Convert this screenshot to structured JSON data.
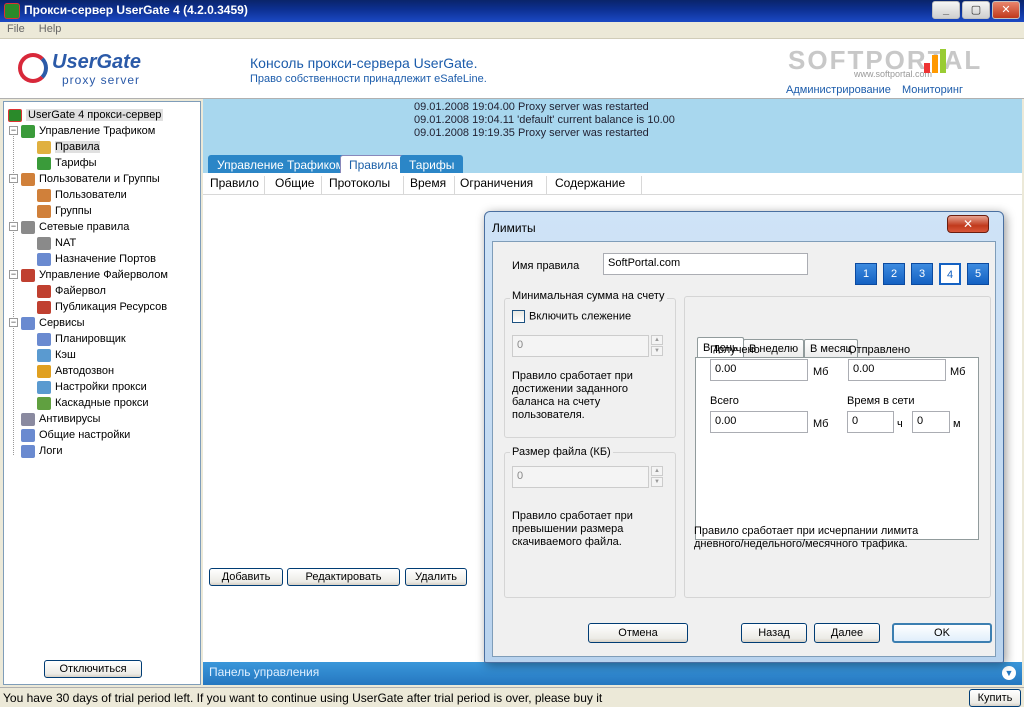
{
  "window": {
    "title": "Прокси-сервер UserGate 4 (4.2.0.3459)",
    "buttons": {
      "minimize": "_",
      "maximize": "▢",
      "close": "✕"
    }
  },
  "menu": [
    "File",
    "Help"
  ],
  "header": {
    "logo_brand": "UserGate",
    "logo_sub": "proxy server",
    "title": "Консоль прокси-сервера UserGate.",
    "subtitle": "Право собственности принадлежит eSafeLine.",
    "watermark_big": "SOFTPORTAL",
    "watermark_small": "www.softportal.com",
    "links": [
      "Администрирование",
      "Мониторинг"
    ]
  },
  "tree": {
    "root": "UserGate 4 прокси-сервер",
    "items": [
      {
        "label": "Управление Трафиком",
        "level": 1,
        "icon": "traffic-icon",
        "color": "#3a9b3a"
      },
      {
        "label": "Правила",
        "level": 2,
        "icon": "rules-icon",
        "color": "#e0b040",
        "selected": true
      },
      {
        "label": "Тарифы",
        "level": 2,
        "icon": "tariffs-icon",
        "color": "#3a9b3a"
      },
      {
        "label": "Пользователи и Группы",
        "level": 1,
        "icon": "users-groups-icon",
        "color": "#d0803a"
      },
      {
        "label": "Пользователи",
        "level": 2,
        "icon": "user-icon",
        "color": "#d0803a"
      },
      {
        "label": "Группы",
        "level": 2,
        "icon": "group-icon",
        "color": "#d0803a"
      },
      {
        "label": "Сетевые правила",
        "level": 1,
        "icon": "network-rules-icon",
        "color": "#8a8a8a"
      },
      {
        "label": "NAT",
        "level": 2,
        "icon": "nat-icon",
        "color": "#8a8a8a"
      },
      {
        "label": "Назначение Портов",
        "level": 2,
        "icon": "ports-icon",
        "color": "#6a8ad0"
      },
      {
        "label": "Управление Файерволом",
        "level": 1,
        "icon": "firewall-manage-icon",
        "color": "#c04030"
      },
      {
        "label": "Файервол",
        "level": 2,
        "icon": "firewall-icon",
        "color": "#c04030"
      },
      {
        "label": "Публикация Ресурсов",
        "level": 2,
        "icon": "publish-icon",
        "color": "#c04030"
      },
      {
        "label": "Сервисы",
        "level": 1,
        "icon": "services-icon",
        "color": "#6a8ad0"
      },
      {
        "label": "Планировщик",
        "level": 2,
        "icon": "scheduler-icon",
        "color": "#6a8ad0"
      },
      {
        "label": "Кэш",
        "level": 2,
        "icon": "cache-icon",
        "color": "#5a9ad0"
      },
      {
        "label": "Автодозвон",
        "level": 2,
        "icon": "autodial-icon",
        "color": "#e0a020"
      },
      {
        "label": "Настройки прокси",
        "level": 2,
        "icon": "proxy-settings-icon",
        "color": "#5a9ad0"
      },
      {
        "label": "Каскадные прокси",
        "level": 2,
        "icon": "cascade-proxy-icon",
        "color": "#60a040"
      },
      {
        "label": "Антивирусы",
        "level": 1,
        "icon": "antivirus-icon",
        "color": "#8a8aa0"
      },
      {
        "label": "Общие настройки",
        "level": 1,
        "icon": "settings-icon",
        "color": "#6a8ad0"
      },
      {
        "label": "Логи",
        "level": 1,
        "icon": "logs-icon",
        "color": "#6a8ad0"
      }
    ],
    "disconnect": "Отключиться"
  },
  "log": [
    "09.01.2008 19:04.00 Proxy server was restarted",
    "09.01.2008 19:04.11 'default' current balance is 10.00",
    "09.01.2008 19:19.35 Proxy server was restarted"
  ],
  "tabs": [
    "Управление Трафиком",
    "Правила",
    "Тарифы"
  ],
  "columns": [
    "Правило",
    "Общие",
    "Протоколы",
    "Время",
    "Ограничения",
    "Содержание"
  ],
  "actions": {
    "add": "Добавить",
    "edit": "Редактировать",
    "delete": "Удалить"
  },
  "panel_footer": "Панель управления",
  "status": {
    "text": "You have 30 days of trial period left. If you want to continue using UserGate after trial period is over, please buy it",
    "buy": "Купить"
  },
  "dialog": {
    "title": "Лимиты",
    "close": "✕",
    "rule_name_label": "Имя правила",
    "rule_name_value": "SoftPortal.com",
    "steps": [
      "1",
      "2",
      "3",
      "4",
      "5"
    ],
    "active_step": "4",
    "min_sum_title": "Минимальная сумма на счету",
    "enable_tracking": "Включить слежение",
    "min_sum_value": "0",
    "min_sum_desc": "Правило сработает при достижении заданного баланса на счету пользователя.",
    "file_size_title": "Размер файла (КБ)",
    "file_size_value": "0",
    "file_size_desc": "Правило сработает при превышении размера скачиваемого файла.",
    "period_tabs": [
      "В день",
      "В неделю",
      "В месяц"
    ],
    "received_label": "Получено",
    "received_value": "0.00",
    "sent_label": "Отправлено",
    "sent_value": "0.00",
    "total_label": "Всего",
    "total_value": "0.00",
    "unit_mb": "Мб",
    "online_label": "Время в сети",
    "hours_value": "0",
    "hours_unit": "ч",
    "minutes_value": "0",
    "minutes_unit": "м",
    "traffic_desc": "Правило сработает при исчерпании лимита дневного/недельного/месячного трафика.",
    "cancel": "Отмена",
    "back": "Назад",
    "next": "Далее",
    "ok": "OK"
  }
}
